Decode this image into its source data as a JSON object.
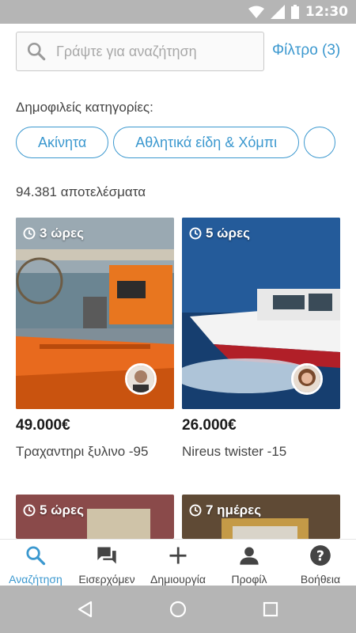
{
  "status_bar": {
    "time": "12:30"
  },
  "search": {
    "placeholder": "Γράψτε για αναζήτηση",
    "value": ""
  },
  "filter": {
    "label": "Φίλτρο (3)"
  },
  "categories": {
    "label": "Δημοφιλείς κατηγορίες:",
    "items": [
      "Ακίνητα",
      "Αθλητικά είδη & Χόμπι"
    ]
  },
  "results": {
    "count_label": "94.381 αποτελέσματα"
  },
  "listings": [
    {
      "time": "3 ώρες",
      "price": "49.000€",
      "title": "Τραχαντηρι ξυλινο -95"
    },
    {
      "time": "5 ώρες",
      "price": "26.000€",
      "title": "Nireus twister -15"
    },
    {
      "time": "5 ώρες"
    },
    {
      "time": "7 ημέρες"
    }
  ],
  "bottom_nav": {
    "items": [
      "Αναζήτηση",
      "Εισερχόμεν",
      "Δημιουργία",
      "Προφίλ",
      "Βοήθεια"
    ],
    "active_color": "#3b98cf"
  }
}
